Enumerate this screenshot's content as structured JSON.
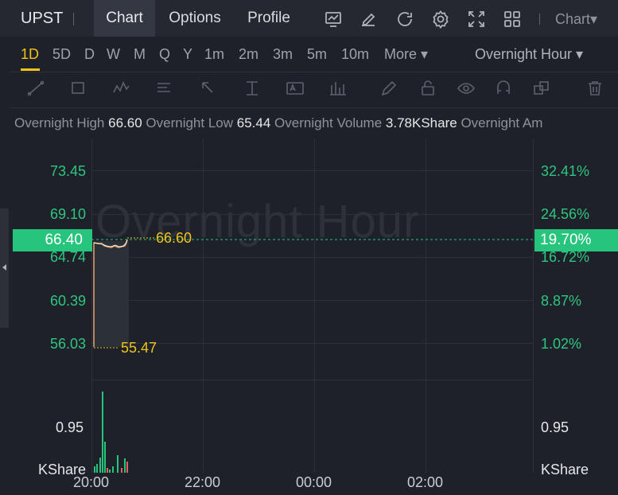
{
  "header": {
    "ticker": "UPST",
    "tabs": [
      {
        "label": "Chart",
        "active": true
      },
      {
        "label": "Options",
        "active": false
      },
      {
        "label": "Profile",
        "active": false
      }
    ],
    "chart_type_label": "Chart▾"
  },
  "timeframes": {
    "items": [
      "1D",
      "5D",
      "D",
      "W",
      "M",
      "Q",
      "Y",
      "1m",
      "2m",
      "3m",
      "5m",
      "10m",
      "More ▾"
    ],
    "selected": "1D",
    "session_label": "Overnight Hour ▾"
  },
  "info_line": {
    "high_label": "Overnight High",
    "high_value": "66.60",
    "low_label": "Overnight Low",
    "low_value": "65.44",
    "volume_label": "Overnight Volume",
    "volume_value": "3.78KShare",
    "amount_label": "Overnight Am"
  },
  "watermark": "Overnight Hour",
  "chart": {
    "left_ticks": [
      "73.45",
      "69.10",
      "64.74",
      "60.39",
      "56.03"
    ],
    "right_ticks": [
      "32.41%",
      "24.56%",
      "16.72%",
      "8.87%",
      "1.02%"
    ],
    "current_price": "66.40",
    "current_change": "19.70%",
    "high_marker": "66.60",
    "low_marker": "55.47",
    "volume_tick": "0.95",
    "volume_unit": "KShare",
    "x_ticks": [
      "20:00",
      "22:00",
      "00:00",
      "02:00"
    ]
  },
  "colors": {
    "up": "#27c47e",
    "accent": "#f0c419",
    "background": "#1e2129"
  }
}
